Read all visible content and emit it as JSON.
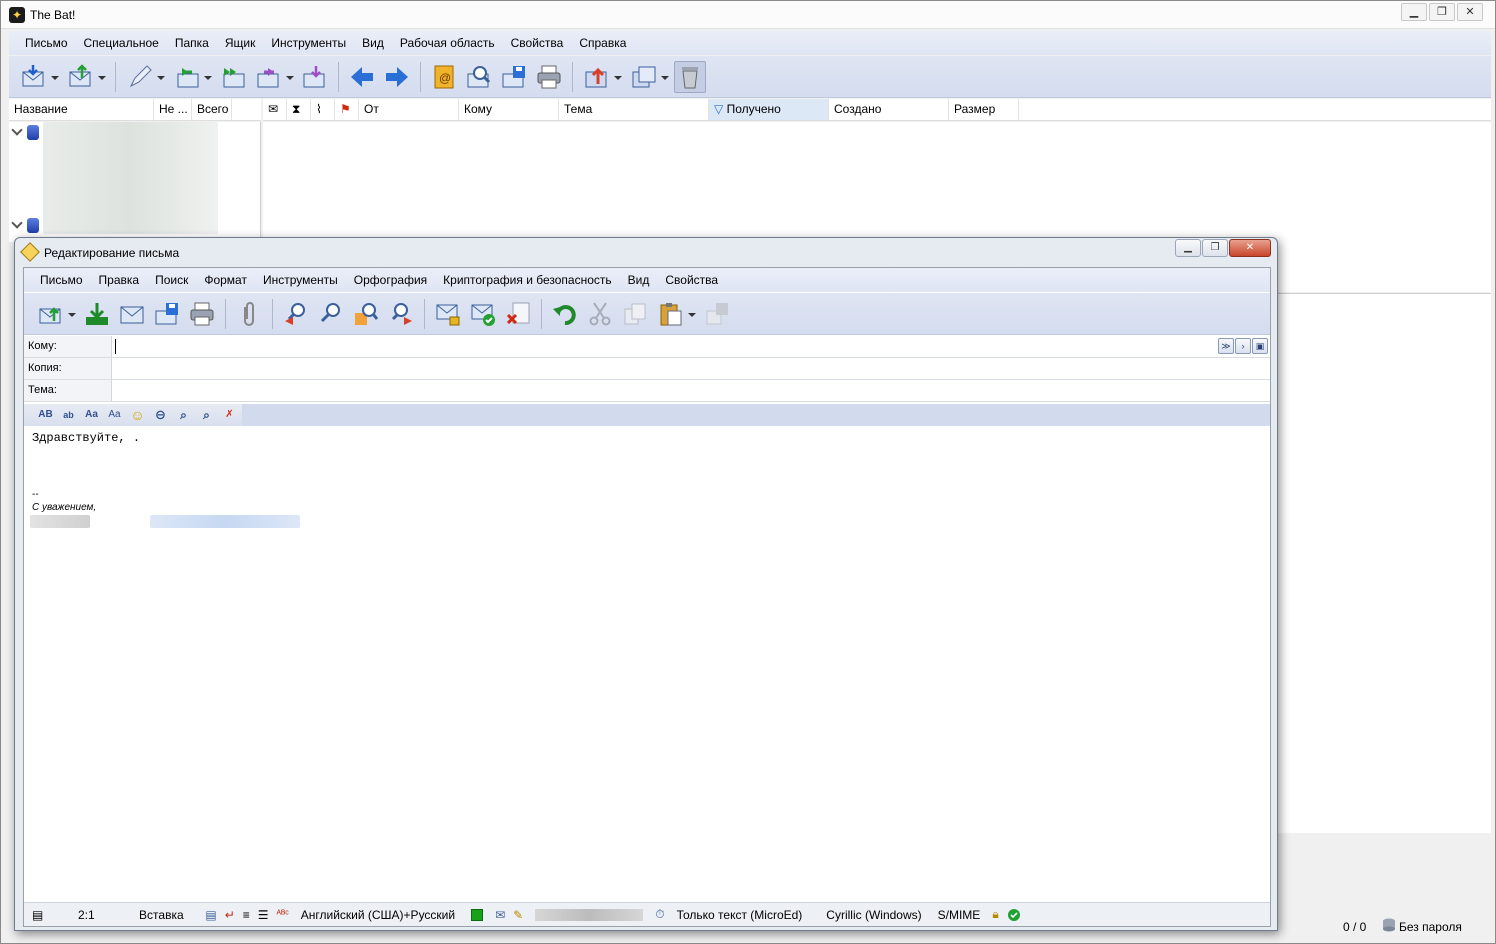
{
  "main_window": {
    "title": "The Bat!",
    "menu": [
      "Письмо",
      "Специальное",
      "Папка",
      "Ящик",
      "Инструменты",
      "Вид",
      "Рабочая область",
      "Свойства",
      "Справка"
    ],
    "folder_columns": [
      "Название",
      "Не ...",
      "Всего"
    ],
    "message_columns": [
      "От",
      "Кому",
      "Тема",
      "Получено",
      "Создано",
      "Размер"
    ],
    "status": {
      "count": "0 / 0",
      "password": "Без пароля"
    }
  },
  "editor": {
    "title": "Редактирование письма",
    "menu": [
      "Письмо",
      "Правка",
      "Поиск",
      "Формат",
      "Инструменты",
      "Орфография",
      "Криптография и безопасность",
      "Вид",
      "Свойства"
    ],
    "fields": {
      "to_label": "Кому:",
      "cc_label": "Копия:",
      "subject_label": "Тема:",
      "to_value": "",
      "cc_value": "",
      "subject_value": ""
    },
    "format_buttons": [
      "AB",
      "ab",
      "Aa",
      "Aa"
    ],
    "body": {
      "greeting": "Здравствуйте, .",
      "sig_separator": "--",
      "regards": "С уважением,"
    },
    "status": {
      "position": "2:1",
      "mode": "Вставка",
      "language": "Английский (США)+Русский",
      "format": "Только текст (MicroEd)",
      "charset": "Cyrillic (Windows)",
      "security": "S/MIME"
    }
  },
  "colors": {
    "accent_blue": "#2a6fd6",
    "green": "#1aa11a",
    "toolbar_bg": "#dfe5f3"
  }
}
